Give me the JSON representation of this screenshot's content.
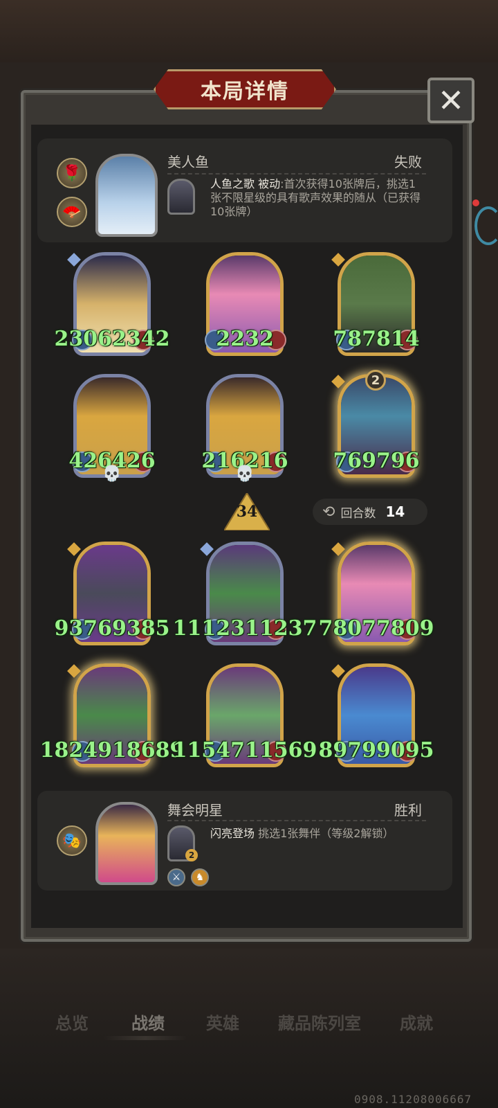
{
  "title": "本局详情",
  "close_label": "✕",
  "top_player": {
    "hero_name": "美人鱼",
    "result": "失败",
    "skill_name": "人鱼之歌",
    "skill_type": "被动",
    "skill_desc": ":首次获得10张牌后，挑选1张不限星级的具有歌声效果的随从（已获得10张牌）"
  },
  "bottom_player": {
    "hero_name": "舞会明星",
    "result": "胜利",
    "skill_name": "闪亮登场",
    "skill_desc": " 挑选1张舞伴（等级2解锁）",
    "skill_level": "2"
  },
  "minions": [
    {
      "atk": "2306",
      "hp": "2342",
      "frame": "silver",
      "tier": "blue",
      "glow": false,
      "dead": false,
      "golden": "",
      "art": "linear-gradient(180deg,#2c2b4a 0%,#d6b26a 50%,#f0e0b0 100%)"
    },
    {
      "atk": "22",
      "hp": "32",
      "frame": "gold",
      "tier": "",
      "glow": false,
      "dead": false,
      "golden": "",
      "art": "linear-gradient(180deg,#5a3a6a 0%,#e88ab4 40%,#8a5ab0 100%)"
    },
    {
      "atk": "787",
      "hp": "814",
      "frame": "gold",
      "tier": "gold",
      "glow": false,
      "dead": false,
      "golden": "",
      "art": "linear-gradient(180deg,#4a6a3a 0%,#5a7a4a 50%,#2a2a2a 100%)"
    },
    {
      "atk": "426",
      "hp": "426",
      "frame": "silver",
      "tier": "",
      "glow": false,
      "dead": true,
      "golden": "",
      "art": "linear-gradient(180deg,#3a2a2a 0%,#d9a640 40%,#c9a04a 100%)"
    },
    {
      "atk": "216",
      "hp": "216",
      "frame": "silver",
      "tier": "",
      "glow": false,
      "dead": true,
      "golden": "",
      "art": "linear-gradient(180deg,#3a2a2a 0%,#d9a640 40%,#c9a04a 100%)"
    },
    {
      "atk": "769",
      "hp": "796",
      "frame": "gold",
      "tier": "gold",
      "glow": true,
      "dead": false,
      "golden": "2",
      "art": "linear-gradient(180deg,#3a4a6a 0%,#4a8aa6 40%,#4a2a4a 100%)"
    },
    {
      "atk": "9376",
      "hp": "9385",
      "frame": "gold",
      "tier": "gold",
      "glow": false,
      "dead": false,
      "golden": "",
      "art": "linear-gradient(180deg,#6a3a8a 0%,#4a4a5a 50%,#6a3a8a 100%)"
    },
    {
      "atk": "11123",
      "hp": "11237",
      "frame": "silver",
      "tier": "blue",
      "glow": false,
      "dead": false,
      "golden": "",
      "art": "linear-gradient(180deg,#5a3a7a 0%,#4a8a4a 50%,#6a3a7a 100%)"
    },
    {
      "atk": "7807",
      "hp": "7809",
      "frame": "gold",
      "tier": "gold",
      "glow": true,
      "dead": false,
      "golden": "",
      "art": "linear-gradient(180deg,#5a3a6a 0%,#e88ab4 40%,#8a5ab0 100%)"
    },
    {
      "atk": "18249",
      "hp": "18689",
      "frame": "gold",
      "tier": "gold",
      "glow": true,
      "dead": false,
      "golden": "",
      "art": "linear-gradient(180deg,#6a3a7a 0%,#4a8a4a 50%,#6a3a7a 100%)"
    },
    {
      "atk": "11547",
      "hp": "11569",
      "frame": "gold",
      "tier": "",
      "glow": false,
      "dead": false,
      "golden": "",
      "art": "linear-gradient(180deg,#6a3a7a 0%,#6aa66a 50%,#6a3a7a 100%)"
    },
    {
      "atk": "8979",
      "hp": "9095",
      "frame": "gold",
      "tier": "gold",
      "glow": false,
      "dead": false,
      "golden": "",
      "art": "linear-gradient(180deg,#4a3a8a 0%,#4a8ad0 50%,#3a5aa6 100%)"
    }
  ],
  "tavern_tier": "34",
  "turns": {
    "label": "回合数",
    "value": "14"
  },
  "tabs": [
    "总览",
    "战绩",
    "英雄",
    "藏品陈列室",
    "成就"
  ],
  "active_tab": 1,
  "watermark": "0908.11208006667",
  "icons": {
    "close": "close-icon",
    "turns": "cycle-icon",
    "skull": "skull-icon"
  },
  "colors": {
    "stat_green": "#9af28a",
    "title_red": "#7a1a14",
    "gold_frame": "#d1a44a",
    "silver_frame": "#7b83a5"
  }
}
